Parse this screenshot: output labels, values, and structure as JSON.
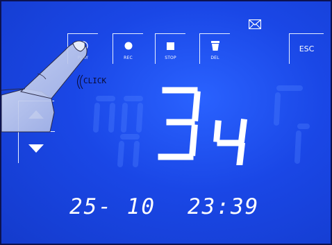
{
  "status": {
    "message_icon": "envelope-icon"
  },
  "toolbar": {
    "buttons": [
      {
        "id": "play",
        "label": "PLAY",
        "icon": "play-icon"
      },
      {
        "id": "rec",
        "label": "REC",
        "icon": "record-icon"
      },
      {
        "id": "stop",
        "label": "STOP",
        "icon": "stop-icon"
      },
      {
        "id": "del",
        "label": "DEL",
        "icon": "trash-icon"
      }
    ],
    "esc_label": "ESC"
  },
  "nav": {
    "up_icon": "arrow-up-icon",
    "down_icon": "arrow-down-icon"
  },
  "display": {
    "value": "34",
    "date": "25- 10",
    "time": "23:39"
  },
  "overlay": {
    "click_text": "CLICK"
  },
  "colors": {
    "screen": "#1a47e6",
    "segment": "#ffffff",
    "ghost": "#5a8cff"
  }
}
